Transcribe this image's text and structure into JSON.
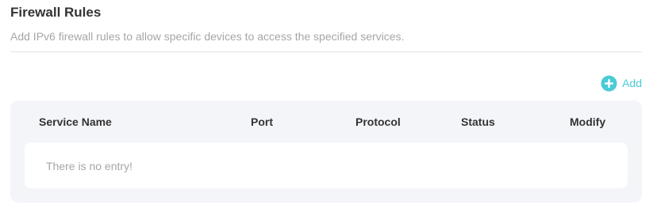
{
  "section": {
    "title": "Firewall Rules",
    "description": "Add IPv6 firewall rules to allow specific devices to access the specified services."
  },
  "toolbar": {
    "add_label": "Add",
    "add_icon": "plus-circle-icon",
    "accent_color": "#4acbd6"
  },
  "table": {
    "columns": [
      "Service Name",
      "Port",
      "Protocol",
      "Status",
      "Modify"
    ],
    "rows": [],
    "empty_text": "There is no entry!"
  }
}
